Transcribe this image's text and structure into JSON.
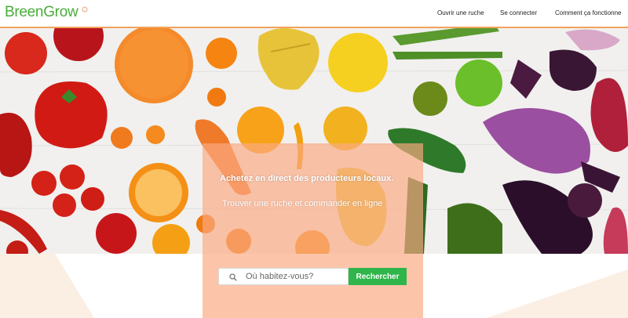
{
  "header": {
    "logo_text": "BreenGrow",
    "nav": [
      {
        "label": "Ouvrir une ruche"
      },
      {
        "label": "Se connecter"
      },
      {
        "label": "Comment ça fonctionne"
      }
    ]
  },
  "hero": {
    "tagline": "Achetez en direct des producteurs locaux.",
    "subline": "Trouver une ruche et commander en ligne"
  },
  "search": {
    "placeholder": "Où habitez-vous?",
    "value": "",
    "button_label": "Rechercher"
  },
  "colors": {
    "brand_green": "#4aad3a",
    "button_green": "#2fb54a",
    "header_rule": "#f2a35c",
    "overlay": "#faaa82"
  },
  "icons": {
    "search": "search-icon",
    "logo_mark": "sprout-icon"
  }
}
